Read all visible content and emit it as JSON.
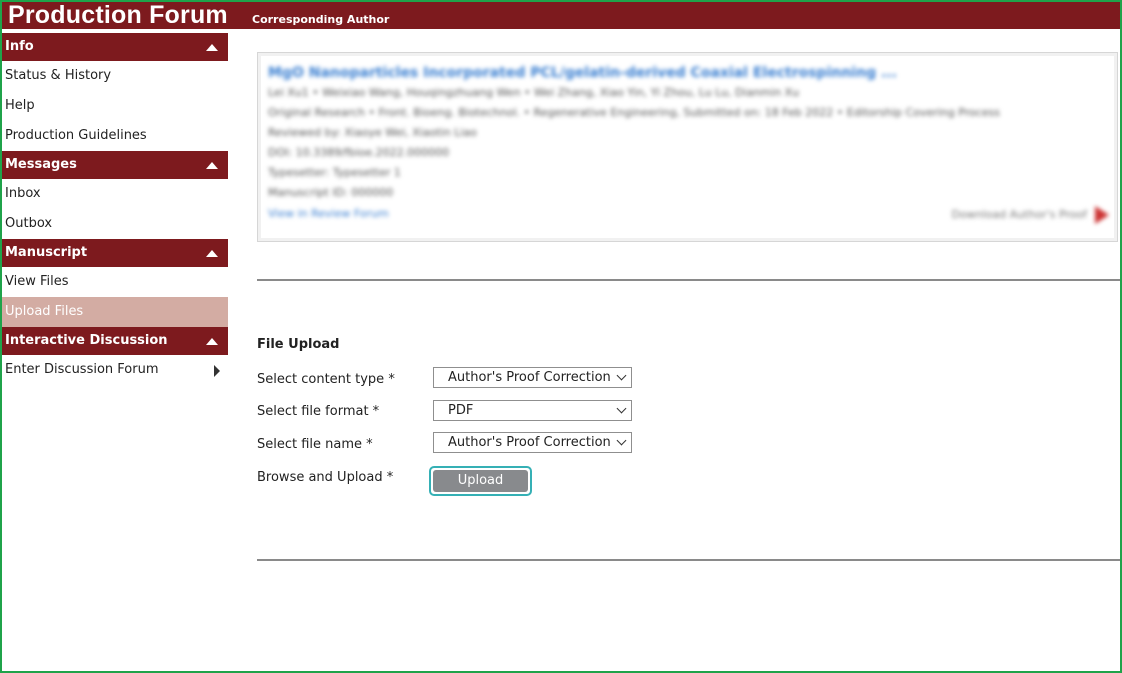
{
  "header": {
    "title": "Production Forum",
    "role": "Corresponding Author"
  },
  "sidebar": {
    "sections": [
      {
        "title": "Info",
        "items": [
          "Status & History",
          "Help",
          "Production Guidelines"
        ]
      },
      {
        "title": "Messages",
        "items": [
          "Inbox",
          "Outbox"
        ]
      },
      {
        "title": "Manuscript",
        "items": [
          "View Files",
          "Upload Files"
        ]
      },
      {
        "title": "Interactive Discussion",
        "items": [
          "Enter Discussion Forum"
        ]
      }
    ],
    "active_item": "Upload Files"
  },
  "manuscript_card": {
    "title": "MgO Nanoparticles Incorporated PCL/gelatin-derived Coaxial Electrospinning ...",
    "lines": [
      "Lei Xu1 • Weixiao Wang, Houqingzhuang Wen • Wei Zhang, Xiao Yin, Yi Zhou, Lu Lu, Dianmin Xu",
      "Original Research • Front. Bioeng. Biotechnol. • Regenerative Engineering, Submitted on: 18 Feb 2022 • Editorship Covering Process",
      "Reviewed by: Xiaoye Wei, Xiaotin Liao",
      "DOI: 10.3389/fbioe.2022.000000",
      "Typesetter: Typesetter 1",
      "Manuscript ID: 000000"
    ],
    "link": "View in Review Forum",
    "download_label": "Download Author's Proof"
  },
  "upload_form": {
    "title": "File Upload",
    "content_type_label": "Select content type *",
    "content_type_value": "Author's Proof Correction",
    "file_format_label": "Select file format *",
    "file_format_value": "PDF",
    "file_name_label": "Select file name *",
    "file_name_value": "Author's Proof Correction",
    "browse_label": "Browse and Upload *",
    "upload_button": "Upload"
  },
  "colors": {
    "brand": "#7d1a1e",
    "active_item": "#d3aca3",
    "upload_button": "#888a8d",
    "focus_ring": "#35b0b5",
    "frame_border": "#1fa34a"
  },
  "icons": {
    "section_toggle": "caret-up-icon",
    "submenu": "caret-right-icon",
    "select": "chevron-down-icon",
    "pdf": "pdf-download-icon"
  }
}
